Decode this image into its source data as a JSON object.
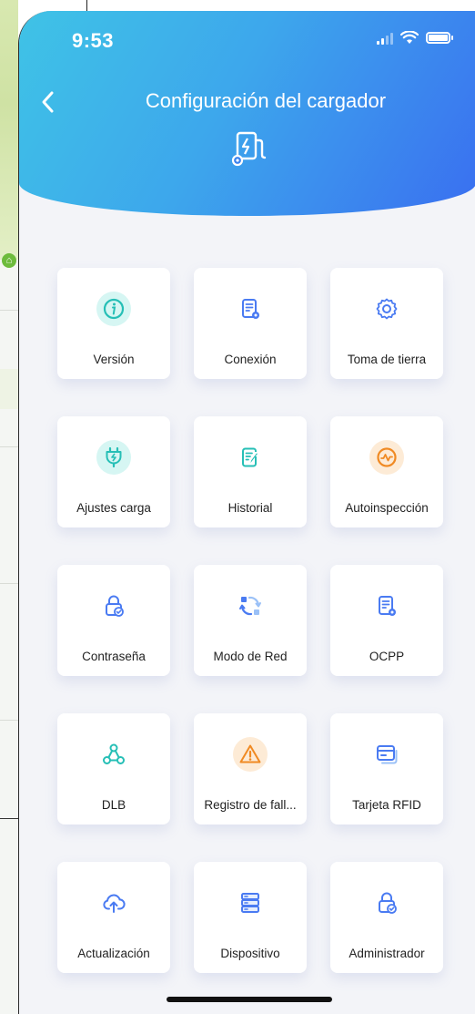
{
  "status_bar": {
    "time": "9:53"
  },
  "header": {
    "title": "Configuración del cargador",
    "back_icon": "chevron-left-icon",
    "header_icon": "charger-icon"
  },
  "colors": {
    "header_gradient_start": "#3fc3e6",
    "header_gradient_end": "#3a6ff0",
    "teal": "#2ec4c4",
    "blue": "#4a7bf2",
    "orange": "#f08a23"
  },
  "grid": [
    {
      "label": "Versión",
      "icon": "info-icon"
    },
    {
      "label": "Conexión",
      "icon": "document-settings-icon"
    },
    {
      "label": "Toma de tierra",
      "icon": "gear-icon"
    },
    {
      "label": "Ajustes carga",
      "icon": "plug-icon"
    },
    {
      "label": "Historial",
      "icon": "document-edit-icon"
    },
    {
      "label": "Autoinspección",
      "icon": "diagnostic-icon"
    },
    {
      "label": "Contraseña",
      "icon": "lock-check-icon"
    },
    {
      "label": "Modo de Red",
      "icon": "network-sync-icon"
    },
    {
      "label": "OCPP",
      "icon": "document-settings-icon"
    },
    {
      "label": "DLB",
      "icon": "network-nodes-icon"
    },
    {
      "label": "Registro de fall...",
      "icon": "warning-icon"
    },
    {
      "label": "Tarjeta RFID",
      "icon": "rfid-card-icon"
    },
    {
      "label": "Actualización",
      "icon": "cloud-upload-icon"
    },
    {
      "label": "Dispositivo",
      "icon": "server-icon"
    },
    {
      "label": "Administrador",
      "icon": "lock-check-icon"
    }
  ]
}
